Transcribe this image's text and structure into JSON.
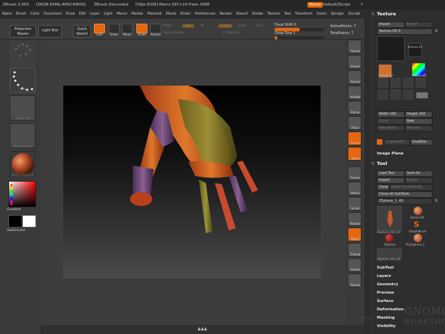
{
  "title_bar": {
    "app": "ZBrush 3.5R3",
    "session": "[ZKQB-DHNL-AFAZ-KMVQ]",
    "document": "ZBrush Document",
    "stats": "[Objs 8336]  Mems 587+14  Frees 3588",
    "menus_button": "Menus",
    "script": "DefaultZScript"
  },
  "menu_bar": [
    "Alpha",
    "Brush",
    "Color",
    "Document",
    "Draw",
    "Edit",
    "Layer",
    "Light",
    "Macro",
    "Marker",
    "Material",
    "Movie",
    "Picker",
    "Preferences",
    "Render",
    "Stencil",
    "Stroke",
    "Texture",
    "Tool",
    "Transform",
    "Zoom",
    "Zplugin",
    "Zscript"
  ],
  "top_shelf": {
    "projection_master": "Projection Master",
    "lightbox": "Light Box",
    "quick_sketch": "Quick Sketch",
    "tools": [
      {
        "label": "Edit",
        "active": true
      },
      {
        "label": "Draw",
        "active": false
      },
      {
        "label": "Move",
        "active": false
      },
      {
        "label": "Scale",
        "active": true
      },
      {
        "label": "Rotate",
        "active": false
      }
    ],
    "dim_labels": [
      "Mrgb",
      "Rgb",
      "M",
      "Zadd",
      "Zsub",
      "Zcut",
      "Rgb Intensity",
      "Z Intensity"
    ],
    "focal_shift_label": "Focal Shift",
    "focal_shift_value": "0",
    "focal_shift_fraction": 0.5,
    "draw_size_label": "Draw Size",
    "draw_size_value": "1",
    "draw_size_fraction": 0.05,
    "active_points": "ActivePoints: 7",
    "total_points": "TotalPoints: 7"
  },
  "left_shelf": {
    "captions": [
      "",
      "Dots",
      "Alpha Off",
      "Texture Off",
      "Basic Material"
    ],
    "gradient_label": "Gradient",
    "switch_color_label": "SwitchColor"
  },
  "right_shelf": [
    "Scroll",
    "Zoom",
    "Actual",
    "AAHalf",
    "Persp",
    "Floor",
    "Local",
    "Qxyz",
    "",
    "Frame",
    "Move",
    "Scale",
    "Rotate",
    "PolyF",
    "Transp",
    "Ghost",
    "Xpose"
  ],
  "bottom_strip": "▲▲▲",
  "right_tray": {
    "texture_title": "Texture",
    "import_label": "Import",
    "export_label": "Export",
    "texture_off": "Texture Off",
    "texture_off_value": "0",
    "texture_slots": [
      "Texture Off",
      "Texture 24",
      "Texture 37",
      "Texture 40"
    ],
    "width_label": "Width 256",
    "height_label": "Height 256",
    "clone_label": "Clone",
    "new_label": "New",
    "make_alpha": "MakeAlpha",
    "remove_label": "Remove",
    "cropandfill": "CropAndFill",
    "grabdoc": "GrabDoc",
    "image_plane": "Image Plane",
    "tool_title": "Tool",
    "load_tool": "Load Tool",
    "save_as": "Save As",
    "tool_import": "Import",
    "tool_export": "Export",
    "tool_clone": "Clone",
    "make_polymesh": "Make PolyMesh3D",
    "clone_all_subtools": "Clone All SubTools",
    "zsphere_label": "ZSphere_1. 46",
    "tool_slots": [
      "ZSphere_Arm_01",
      "Sphere3D",
      "SimpleBrush",
      "ZSphere",
      "PolySphere_1",
      "ZSphere_Arm_01"
    ],
    "subpalettes": [
      "SubTool",
      "Layers",
      "Geometry",
      "Preview",
      "Surface",
      "Deformation",
      "Masking",
      "Visibility"
    ]
  },
  "watermark": {
    "top": "THE",
    "main": "GNOMON",
    "sub": "WORKSHOP"
  }
}
